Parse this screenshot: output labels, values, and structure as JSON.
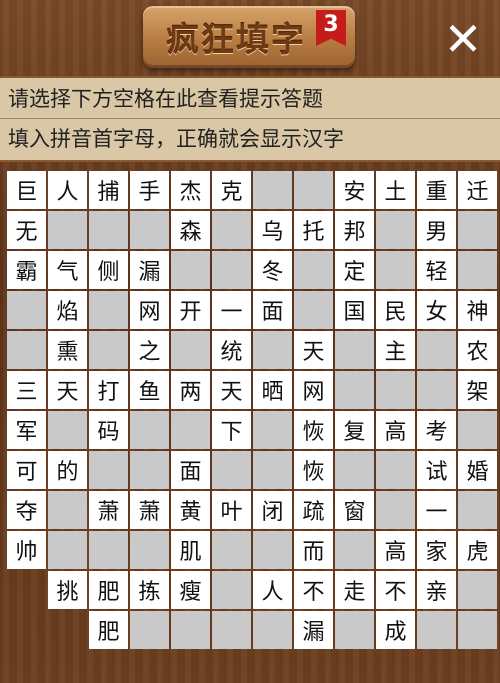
{
  "header": {
    "title": "疯狂填字",
    "level": "3",
    "close_icon": "close-icon"
  },
  "hints": {
    "line1": "请选择下方空格在此查看提示答题",
    "line2": "填入拼音首字母，正确就会显示汉字"
  },
  "board": {
    "rows": [
      [
        "巨",
        "人",
        "捕",
        "手",
        "杰",
        "克",
        "_",
        "_",
        "安",
        "土",
        "重",
        "迁"
      ],
      [
        "无",
        "_",
        "_",
        "_",
        "森",
        "_",
        "乌",
        "托",
        "邦",
        "_",
        "男",
        "_"
      ],
      [
        "霸",
        "气",
        "侧",
        "漏",
        "_",
        "_",
        "冬",
        "_",
        "定",
        "_",
        "轻",
        "_"
      ],
      [
        "_",
        "焰",
        "_",
        "网",
        "开",
        "一",
        "面",
        "_",
        "国",
        "民",
        "女",
        "神"
      ],
      [
        "_",
        "熏",
        "_",
        "之",
        "_",
        "统",
        "_",
        "天",
        "_",
        "主",
        "_",
        "农"
      ],
      [
        "三",
        "天",
        "打",
        "鱼",
        "两",
        "天",
        "晒",
        "网",
        "_",
        "_",
        "_",
        "架"
      ],
      [
        "军",
        "_",
        "码",
        "_",
        "_",
        "下",
        "_",
        "恢",
        "复",
        "高",
        "考",
        "_"
      ],
      [
        "可",
        "的",
        "_",
        "_",
        "面",
        "_",
        "_",
        "恢",
        "_",
        "_",
        "试",
        "婚"
      ],
      [
        "夺",
        "_",
        "萧",
        "萧",
        "黄",
        "叶",
        "闭",
        "疏",
        "窗",
        "_",
        "一",
        "_"
      ],
      [
        "帅",
        "_",
        "_",
        "_",
        "肌",
        "_",
        "_",
        "而",
        "_",
        "高",
        "家",
        "虎"
      ],
      [
        "#",
        "挑",
        "肥",
        "拣",
        "瘦",
        "_",
        "人",
        "不",
        "走",
        "不",
        "亲",
        "_"
      ],
      [
        "#",
        "#",
        "肥",
        "_",
        "_",
        "_",
        "_",
        "漏",
        "_",
        "成",
        "_",
        "_"
      ]
    ]
  }
}
